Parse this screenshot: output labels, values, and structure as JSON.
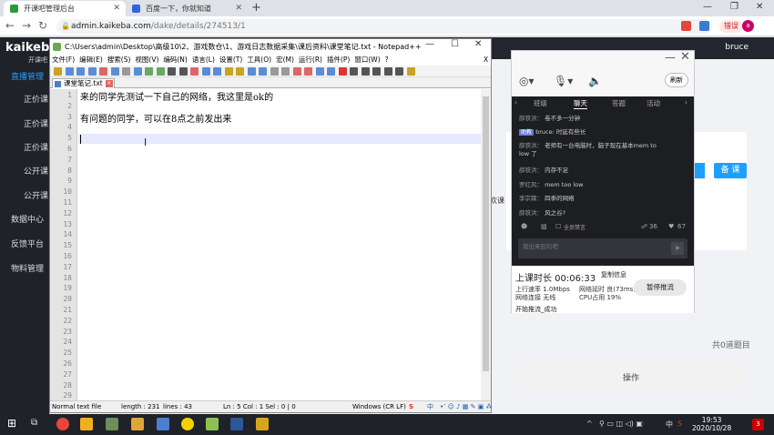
{
  "browser": {
    "tabs": [
      {
        "title": "开课吧管理后台",
        "active": true
      },
      {
        "title": "百度一下，你就知道",
        "active": false
      }
    ],
    "url_host": "admin.kaikeba.com",
    "url_path": "/dake/details/274513/1",
    "error_badge": "错误",
    "profile_initial": "a"
  },
  "webpage": {
    "brand": "kaikeba",
    "brand_sub": "开课吧",
    "sidebar": {
      "items": [
        "直播管理",
        "正价课",
        "正价课",
        "正价课",
        "公开课",
        "公开课",
        "数据中心",
        "反馈平台",
        "物料管理"
      ]
    },
    "user": "bruce",
    "beike_label": "备 课",
    "partial_text": "欢课",
    "total_text": "共0道题目",
    "op_header": "操作"
  },
  "notepad": {
    "title": "C:\\Users\\admin\\Desktop\\高级10\\2、游戏数仓\\1、游戏日志数据采集\\课后资料\\课堂笔记.txt - Notepad++",
    "menu": [
      "文件(F)",
      "编辑(E)",
      "搜索(S)",
      "视图(V)",
      "编码(N)",
      "语言(L)",
      "设置(T)",
      "工具(O)",
      "宏(M)",
      "运行(R)",
      "插件(P)",
      "窗口(W)",
      "?"
    ],
    "tab_label": "课堂笔记.txt",
    "lines": [
      "来的同学先测试一下自己的网络，我这里是ok的",
      "",
      "有问题的同学，可以在8点之前发出来",
      "",
      "",
      "",
      "",
      "",
      "",
      "",
      "",
      "",
      "",
      "",
      "",
      "",
      "",
      "",
      "",
      "",
      "",
      "",
      "",
      "",
      "",
      "",
      "",
      "",
      ""
    ],
    "line_count": 29,
    "status": {
      "type": "Normal text file",
      "length": "length : 231",
      "lines": "lines : 43",
      "pos": "Ln : 5   Col : 1   Sel : 0 | 0",
      "eol": "Windows (CR LF)",
      "ime": "中"
    }
  },
  "live_panel": {
    "refresh": "刷新",
    "tabs": [
      "班级",
      "聊天",
      "答题",
      "活动"
    ],
    "messages": [
      {
        "name": "薛铁洪：",
        "text": "卷不多一分钟",
        "badge": ""
      },
      {
        "name": "",
        "text": "bruce: 时延有些长",
        "badge": "助教"
      },
      {
        "name": "薛铁洪：",
        "text": "老师有一台电脑时，脑子现在基本mem to low 了",
        "badge": ""
      },
      {
        "name": "薛铁洪：",
        "text": "内存不足",
        "badge": ""
      },
      {
        "name": "罗红风：",
        "text": "mem too low",
        "badge": ""
      },
      {
        "name": "李宗霖：",
        "text": "四季的网络",
        "badge": ""
      },
      {
        "name": "薛铁洪：",
        "text": "风之谷?",
        "badge": ""
      }
    ],
    "only_teacher": "全员禁言",
    "online_count": "36",
    "likes": "67",
    "input_placeholder": "我出来回句吧",
    "duration_label": "上课时长 00:06:33",
    "copy_info": "复制信息",
    "upload": "上行速率  1.0Mbps",
    "latency": "网络延时  良(73ms)",
    "connection": "网络连接  无线",
    "cpu": "CPU占用  19%",
    "pause_label": "暂停推流",
    "push_status": "开始推流_成功"
  },
  "taskbar": {
    "time": "19:53",
    "date": "2020/10/28",
    "ime": "中",
    "notifications": "3"
  }
}
